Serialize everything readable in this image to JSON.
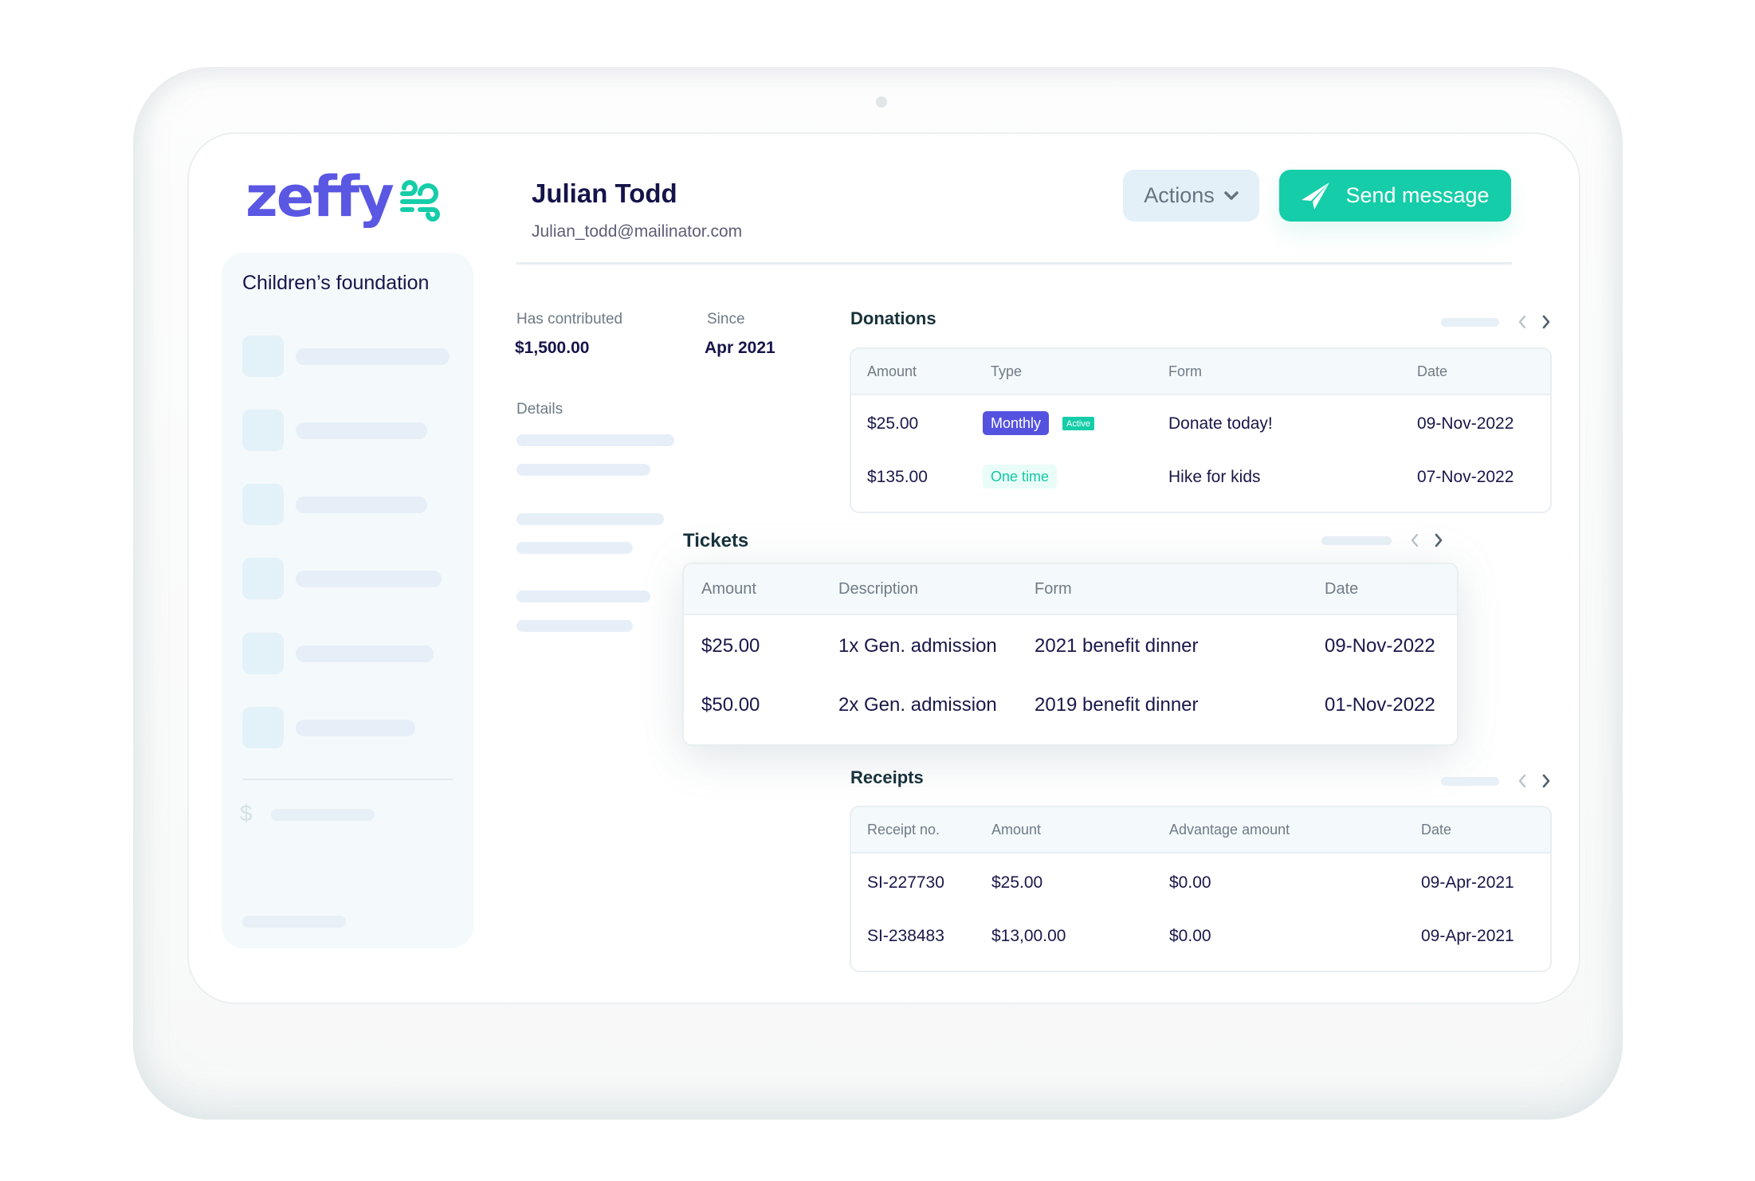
{
  "brand": {
    "name": "zeffy",
    "primary_color": "#5a57e3",
    "accent_color": "#15cda8"
  },
  "sidebar": {
    "organization": "Children’s foundation",
    "currency_symbol": "$"
  },
  "contact": {
    "name": "Julian Todd",
    "email": "Julian_todd@mailinator.com"
  },
  "toolbar": {
    "actions_label": "Actions",
    "send_label": "Send message"
  },
  "stats": {
    "contributed_label": "Has contributed",
    "contributed_value": "$1,500.00",
    "since_label": "Since",
    "since_value": "Apr 2021",
    "details_label": "Details"
  },
  "donations": {
    "title": "Donations",
    "columns": [
      "Amount",
      "Type",
      "Form",
      "Date"
    ],
    "rows": [
      {
        "amount": "$25.00",
        "type": "Monthly",
        "status": "Active",
        "form": "Donate today!",
        "date": "09-Nov-2022"
      },
      {
        "amount": "$135.00",
        "type": "One time",
        "status": "",
        "form": "Hike for kids",
        "date": "07-Nov-2022"
      }
    ]
  },
  "tickets": {
    "title": "Tickets",
    "columns": [
      "Amount",
      "Description",
      "Form",
      "Date"
    ],
    "rows": [
      {
        "amount": "$25.00",
        "description": "1x Gen. admission",
        "form": "2021 benefit dinner",
        "date": "09-Nov-2022"
      },
      {
        "amount": "$50.00",
        "description": "2x Gen. admission",
        "form": "2019 benefit dinner",
        "date": "01-Nov-2022"
      }
    ]
  },
  "receipts": {
    "title": "Receipts",
    "columns": [
      "Receipt no.",
      "Amount",
      "Advantage amount",
      "Date"
    ],
    "rows": [
      {
        "receipt_no": "SI-227730",
        "amount": "$25.00",
        "advantage": "$0.00",
        "date": "09-Apr-2021"
      },
      {
        "receipt_no": "SI-238483",
        "amount": "$13,00.00",
        "advantage": "$0.00",
        "date": "09-Apr-2021"
      }
    ]
  },
  "icons": {
    "logo_mark": "wind-icon",
    "actions_chevron": "chevron-down-icon",
    "send": "paper-plane-icon",
    "pager_prev": "chevron-left-icon",
    "pager_next": "chevron-right-icon"
  }
}
